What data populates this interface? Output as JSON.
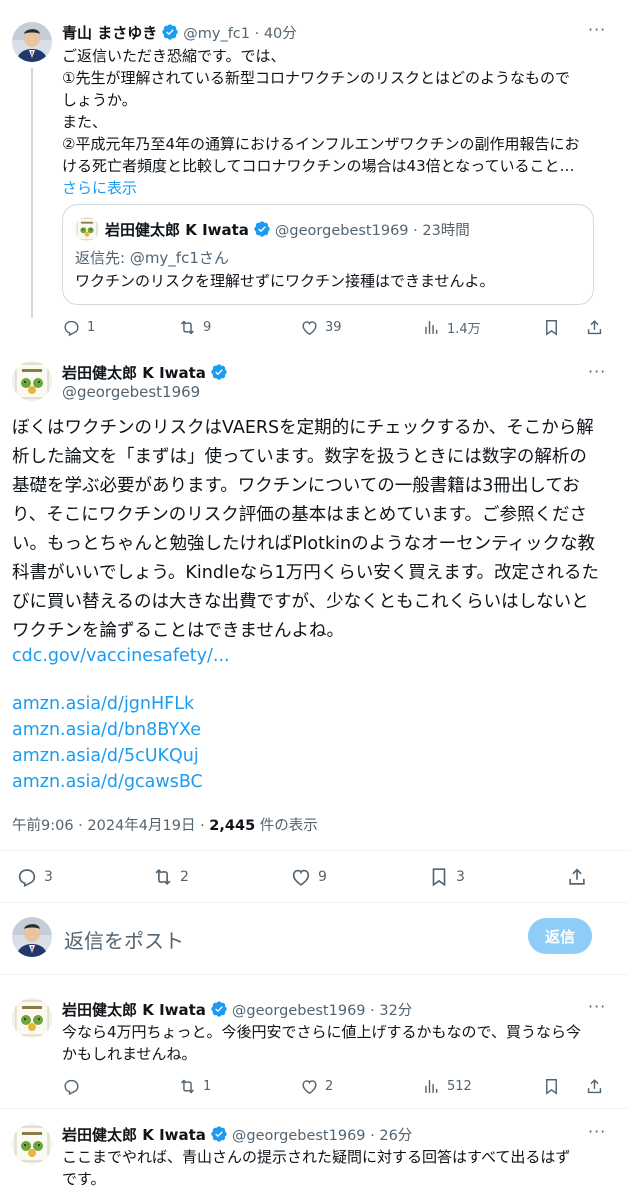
{
  "tweet1": {
    "name": "青山 まさゆき",
    "handle": "@my_fc1",
    "time": "40分",
    "lines": [
      "ご返信いただき恐縮です。では、",
      "①先生が理解されている新型コロナワクチンのリスクとはどのようなもので",
      "しょうか。",
      "また、",
      "②平成元年乃至4年の通算におけるインフルエンザワクチンの副作用報告にお",
      "ける死亡者頻度と比較してコロナワクチンの場合は43倍となっていること…"
    ],
    "show_more": "さらに表示",
    "quote": {
      "name": "岩田健太郎 K Iwata",
      "handle": "@georgebest1969",
      "time": "23時間",
      "reply_to": "返信先: @my_fc1さん",
      "text": "ワクチンのリスクを理解せずにワクチン接種はできませんよ。"
    },
    "actions": {
      "replies": "1",
      "retweets": "9",
      "likes": "39",
      "views": "1.4万"
    }
  },
  "main": {
    "name": "岩田健太郎 K Iwata",
    "handle": "@georgebest1969",
    "lines": [
      "ぼくはワクチンのリスクはVAERSを定期的にチェックするか、そこから解",
      "析した論文を「まずは」使っています。数字を扱うときには数字の解析の",
      "基礎を学ぶ必要があります。ワクチンについての一般書籍は3冊出してお",
      "り、そこにワクチンのリスク評価の基本はまとめています。ご参照くださ",
      "い。もっとちゃんと勉強したければPlotkinのようなオーセンティックな教",
      "科書がいいでしょう。Kindleなら1万円くらい安く買えます。改定されるた",
      "びに買い替えるのは大きな出費ですが、少なくともこれくらいはしないと",
      "ワクチンを論ずることはできませんよね。"
    ],
    "link_cdc": "cdc.gov/vaccinesafety/...",
    "links_amzn": [
      "amzn.asia/d/jgnHFLk",
      "amzn.asia/d/bn8BYXe",
      "amzn.asia/d/5cUKQuj",
      "amzn.asia/d/gcawsBC"
    ],
    "timestamp": "午前9:06 · 2024年4月19日 · ",
    "views_count": "2,445",
    "views_label": " 件の表示",
    "actions": {
      "replies": "3",
      "retweets": "2",
      "likes": "9",
      "bookmarks": "3"
    }
  },
  "compose": {
    "placeholder": "返信をポスト",
    "button": "返信"
  },
  "reply1": {
    "name": "岩田健太郎 K Iwata",
    "handle": "@georgebest1969",
    "time": "32分",
    "lines": [
      "今なら4万円ちょっと。今後円安でさらに値上げするかもなので、買うなら今",
      "かもしれませんね。"
    ],
    "actions": {
      "retweets": "1",
      "likes": "2",
      "views": "512"
    }
  },
  "reply2": {
    "name": "岩田健太郎 K Iwata",
    "handle": "@georgebest1969",
    "time": "26分",
    "lines": [
      "ここまでやれば、青山さんの提示された疑問に対する回答はすべて出るはず",
      "です。"
    ]
  },
  "colors": {
    "link": "#1d9bf0",
    "verified": "#1d9bf0",
    "muted": "#536471",
    "reply_button": "#8ecdf8"
  }
}
